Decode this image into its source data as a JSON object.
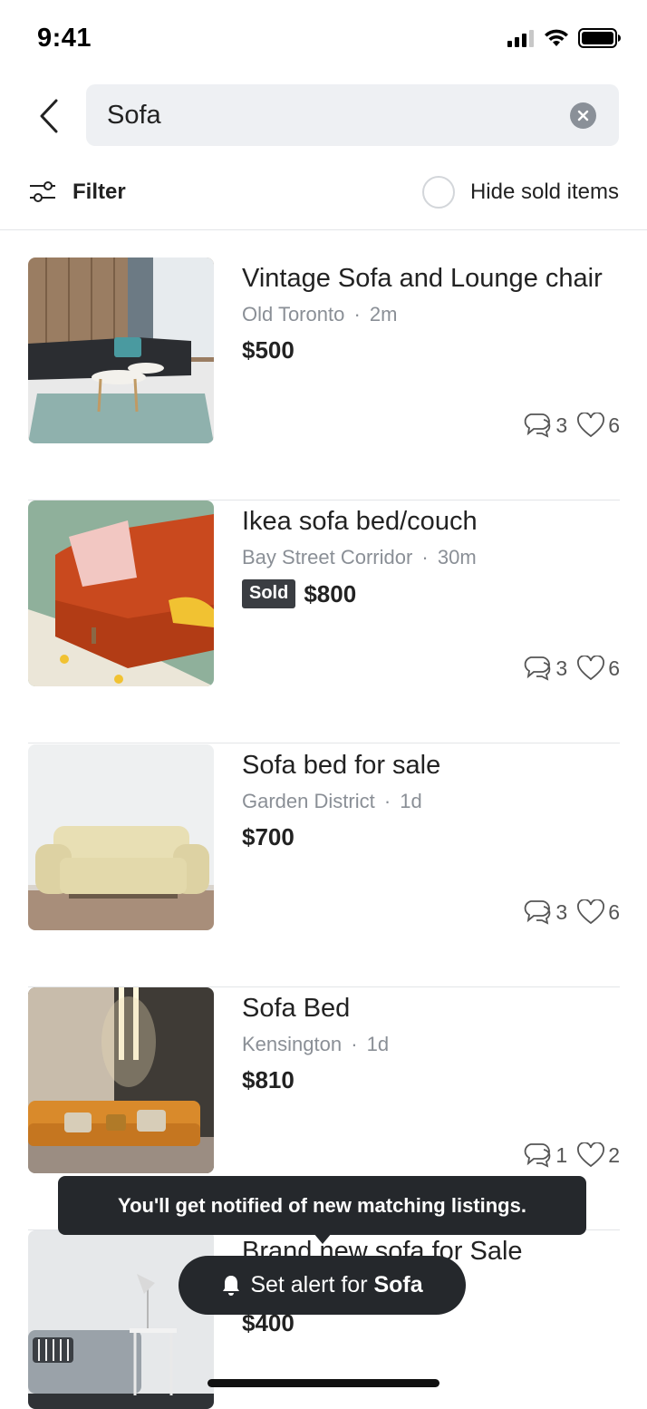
{
  "status_bar": {
    "time": "9:41"
  },
  "search": {
    "query": "Sofa"
  },
  "filter": {
    "label": "Filter",
    "hide_sold_label": "Hide sold items"
  },
  "listings": [
    {
      "title": "Vintage Sofa and Lounge chair",
      "location": "Old Toronto",
      "age": "2m",
      "sold": false,
      "sold_label": "",
      "price": "$500",
      "comments": "3",
      "likes": "6"
    },
    {
      "title": "Ikea sofa bed/couch",
      "location": "Bay Street Corridor",
      "age": "30m",
      "sold": true,
      "sold_label": "Sold",
      "price": "$800",
      "comments": "3",
      "likes": "6"
    },
    {
      "title": "Sofa bed for sale",
      "location": "Garden District",
      "age": "1d",
      "sold": false,
      "sold_label": "",
      "price": "$700",
      "comments": "3",
      "likes": "6"
    },
    {
      "title": "Sofa Bed",
      "location": "Kensington",
      "age": "1d",
      "sold": false,
      "sold_label": "",
      "price": "$810",
      "comments": "1",
      "likes": "2"
    },
    {
      "title": "Brand new sofa for Sale",
      "location": "",
      "age": "",
      "sold": false,
      "sold_label": "",
      "price": "$400",
      "comments": "",
      "likes": ""
    }
  ],
  "tooltip": {
    "text": "You'll get notified of new matching listings."
  },
  "alert_button": {
    "prefix": "Set alert for",
    "keyword": "Sofa"
  },
  "separator": "·",
  "colors": {
    "badge_bg": "#3a3d42",
    "toast_bg": "#25282c",
    "search_bg": "#eef0f3",
    "muted_text": "#8a8f96"
  }
}
